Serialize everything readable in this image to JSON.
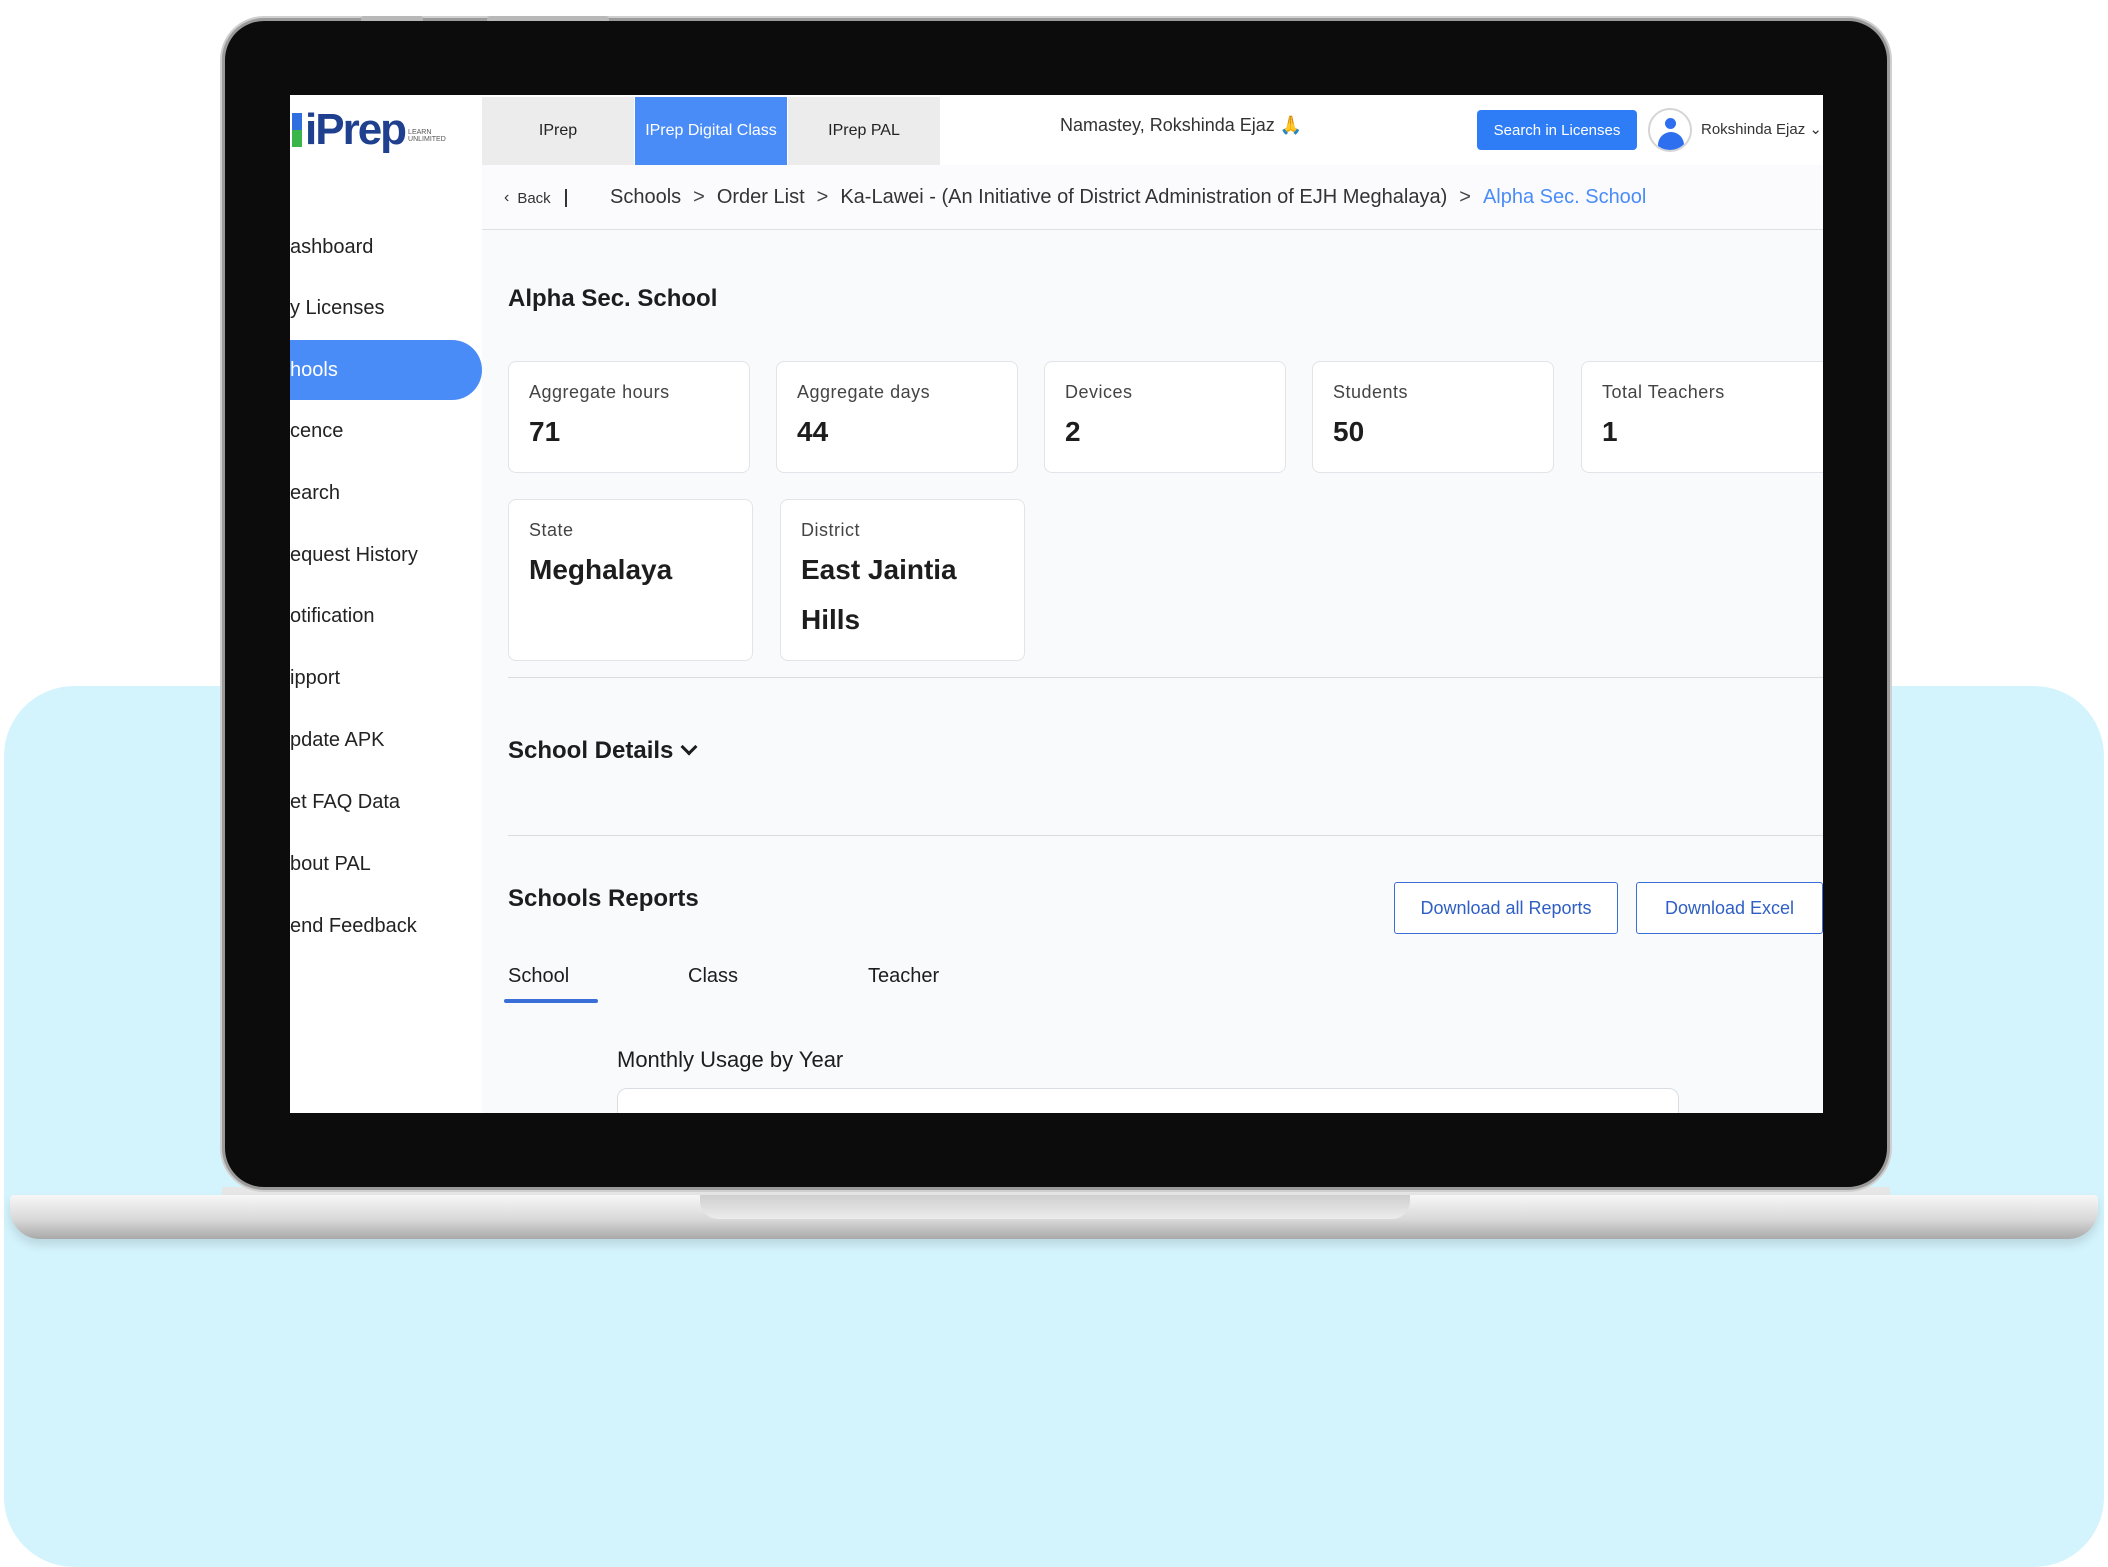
{
  "topbar": {
    "logo_text": "iPrep",
    "logo_tagline": "LEARN UNLIMITED",
    "tabs": [
      {
        "label": "IPrep"
      },
      {
        "label": "IPrep Digital Class"
      },
      {
        "label": "IPrep PAL"
      }
    ],
    "greeting": "Namastey, Rokshinda Ejaz 🙏",
    "search_button": "Search in Licenses",
    "username": "Rokshinda Ejaz ⌄"
  },
  "sidebar": {
    "items": [
      {
        "label": "ashboard"
      },
      {
        "label": "y Licenses"
      },
      {
        "label": "hools"
      },
      {
        "label": "cence"
      },
      {
        "label": "earch"
      },
      {
        "label": "equest History"
      },
      {
        "label": "otification"
      },
      {
        "label": "ipport"
      },
      {
        "label": "pdate APK"
      },
      {
        "label": "et FAQ Data"
      },
      {
        "label": "bout PAL"
      },
      {
        "label": "end Feedback"
      }
    ]
  },
  "breadcrumb": {
    "back": "Back",
    "items": [
      "Schools",
      "Order List",
      "Ka-Lawei - (An Initiative of District Administration of EJH Meghalaya)"
    ],
    "separator": ">",
    "current": "Alpha Sec. School"
  },
  "page_title": "Alpha Sec. School",
  "stats": [
    {
      "label": "Aggregate hours",
      "value": "71"
    },
    {
      "label": "Aggregate days",
      "value": "44"
    },
    {
      "label": "Devices",
      "value": "2"
    },
    {
      "label": "Students",
      "value": "50"
    },
    {
      "label": "Total Teachers",
      "value": "1"
    }
  ],
  "location": [
    {
      "label": "State",
      "value": "Meghalaya"
    },
    {
      "label": "District",
      "value": "East Jaintia Hills"
    }
  ],
  "school_details": "School Details",
  "reports": {
    "title": "Schools Reports",
    "download_all": "Download all Reports",
    "download_excel": "Download Excel",
    "tabs": [
      "School",
      "Class",
      "Teacher"
    ],
    "active_tab": "School",
    "monthly_title": "Monthly Usage by Year"
  },
  "colors": {
    "accent": "#4a8cf7",
    "button": "#2e7df6",
    "backdrop": "#d4f4fd"
  }
}
